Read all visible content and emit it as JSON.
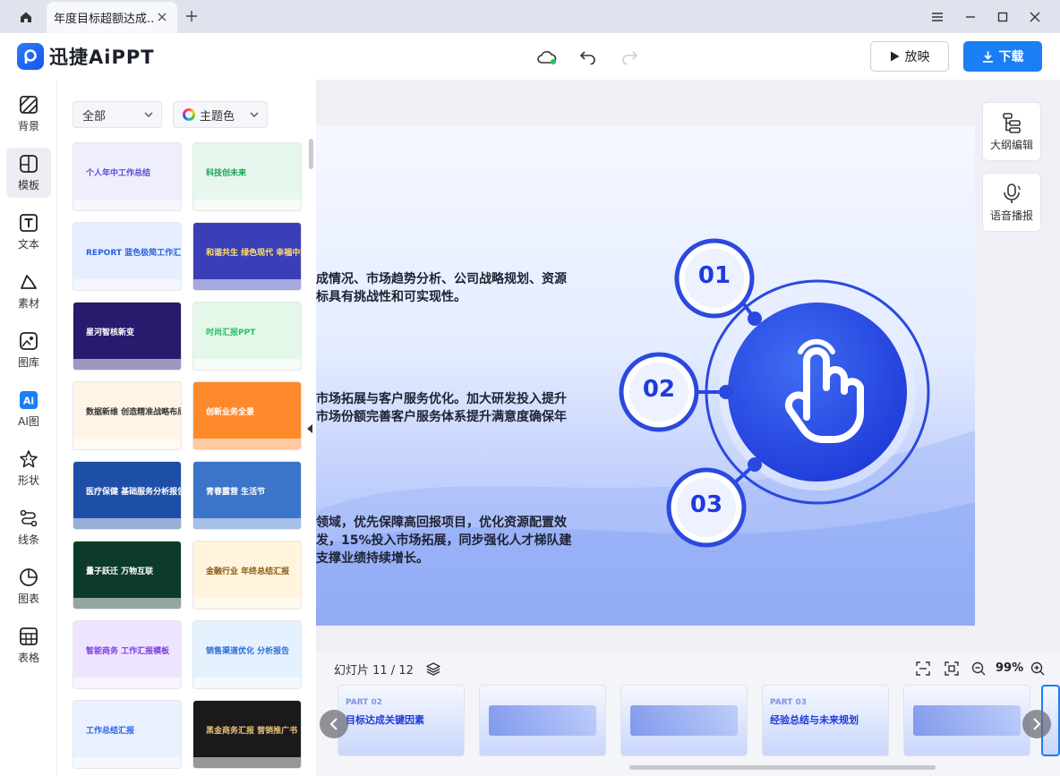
{
  "titlebar": {
    "tab_title": "年度目标超额达成...",
    "new_tab": "+"
  },
  "toolbar": {
    "logo_text": "迅捷AiPPT",
    "play_label": "放映",
    "download_label": "下载"
  },
  "rail": {
    "items": [
      {
        "label": "背景",
        "icon": "stripes-icon"
      },
      {
        "label": "模板",
        "icon": "template-icon"
      },
      {
        "label": "文本",
        "icon": "text-icon"
      },
      {
        "label": "素材",
        "icon": "shape-material-icon"
      },
      {
        "label": "图库",
        "icon": "image-library-icon"
      },
      {
        "label": "AI图",
        "icon": "ai-image-icon"
      },
      {
        "label": "形状",
        "icon": "star-shape-icon"
      },
      {
        "label": "线条",
        "icon": "line-icon"
      },
      {
        "label": "图表",
        "icon": "pie-chart-icon"
      },
      {
        "label": "表格",
        "icon": "table-icon"
      }
    ]
  },
  "panel": {
    "filter_all": "全部",
    "filter_color": "主题色",
    "templates": [
      {
        "text": "个人年中工作总结",
        "bg": "#eeeefd",
        "color": "#5b4bd0"
      },
      {
        "text": "科技创未来",
        "bg": "#e8f7ee",
        "color": "#1aa35b"
      },
      {
        "text": "REPORT 蓝色极简工作汇报",
        "bg": "#e6eeff",
        "color": "#2b63e0"
      },
      {
        "text": "和谐共生 绿色现代 幸福中国",
        "bg": "#3a3fb7",
        "color": "#ffe26a"
      },
      {
        "text": "星河智核新变",
        "bg": "#2a1a6e",
        "color": "#ffffff"
      },
      {
        "text": "时尚汇报PPT",
        "bg": "#e4f8ea",
        "color": "#2bbd6c"
      },
      {
        "text": "数据新维 创造精准战略布局",
        "bg": "#fff4e6",
        "color": "#333333"
      },
      {
        "text": "创新业务全景",
        "bg": "#ff8a2b",
        "color": "#ffffff"
      },
      {
        "text": "医疗保健 基础服务分析报告",
        "bg": "#1e4fa8",
        "color": "#ffffff"
      },
      {
        "text": "青春露营 生活节",
        "bg": "#3b74c8",
        "color": "#ffffff"
      },
      {
        "text": "量子跃迁 万物互联",
        "bg": "#0d3b2a",
        "color": "#ffffff"
      },
      {
        "text": "金融行业 年终总结汇报",
        "bg": "#fff4dc",
        "color": "#8a5a12"
      },
      {
        "text": "智能商务 工作汇报模板",
        "bg": "#efe4ff",
        "color": "#7b3fe0"
      },
      {
        "text": "销售渠道优化 分析报告",
        "bg": "#e6f1ff",
        "color": "#2a6fd6"
      },
      {
        "text": "工作总结汇报",
        "bg": "#e9f0ff",
        "color": "#2c66e0"
      },
      {
        "text": "黑金商务汇报 营销推广书",
        "bg": "#1a1a1a",
        "color": "#e9c27a"
      }
    ]
  },
  "slide": {
    "para1_line1": "成情况、市场趋势分析、公司战略规划、资源",
    "para1_line2": "标具有挑战性和可实现性。",
    "para2_line1": "市场拓展与客户服务优化。加大研发投入提升",
    "para2_line2": "市场份额完善客户服务体系提升满意度确保年",
    "para3_line1": "领域，优先保障高回报项目，优化资源配置效",
    "para3_line2": "发，15%投入市场拓展，同步强化人才梯队建",
    "para3_line3": "支撑业绩持续增长。",
    "node1": "01",
    "node2": "02",
    "node3": "03"
  },
  "side_tools": {
    "outline_label": "大纲编辑",
    "voice_label": "语音播报"
  },
  "bottom": {
    "slide_counter": "幻灯片 11 / 12",
    "zoom": "99%",
    "filmstrip": [
      {
        "part": "PART 02",
        "title": "目标达成关键因素"
      },
      {
        "part": "",
        "title": ""
      },
      {
        "part": "",
        "title": ""
      },
      {
        "part": "PART 03",
        "title": "经验总结与未来规划"
      },
      {
        "part": "",
        "title": ""
      }
    ]
  },
  "colors": {
    "accent": "#1a7ef5",
    "slide_blue": "#2a50e8"
  }
}
